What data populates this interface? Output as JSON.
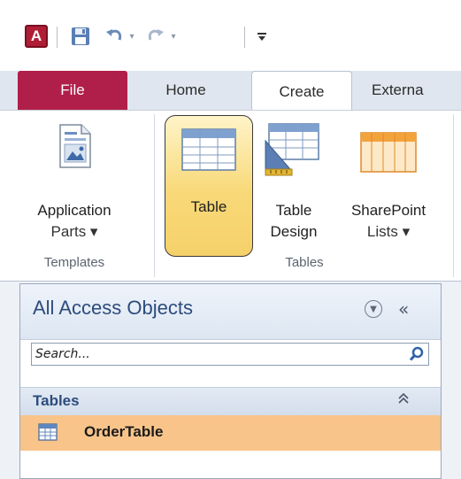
{
  "qat": {
    "app_icon": "A",
    "save_icon": "save-icon",
    "undo_icon": "undo-icon",
    "redo_icon": "redo-icon",
    "customize_icon": "customize-icon"
  },
  "tabs": {
    "file": "File",
    "home": "Home",
    "create": "Create",
    "external": "Externa"
  },
  "ribbon": {
    "templates": {
      "label": "Templates",
      "application_parts": {
        "line1": "Application",
        "line2": "Parts ▾"
      }
    },
    "tables": {
      "label": "Tables",
      "table": {
        "line1": "Table"
      },
      "table_design": {
        "line1": "Table",
        "line2": "Design"
      },
      "sharepoint_lists": {
        "line1": "SharePoint",
        "line2": "Lists ▾"
      }
    }
  },
  "nav": {
    "title": "All Access Objects",
    "collapse": "«",
    "search": {
      "placeholder": "Search..."
    },
    "group": {
      "title": "Tables",
      "toggle": "⌃"
    },
    "items": [
      {
        "label": "OrderTable"
      }
    ]
  },
  "colors": {
    "file_tab": "#b01e4a",
    "selected_button": "#f8d978",
    "selected_item": "#f8c48a",
    "nav_text": "#2c4c7c"
  }
}
